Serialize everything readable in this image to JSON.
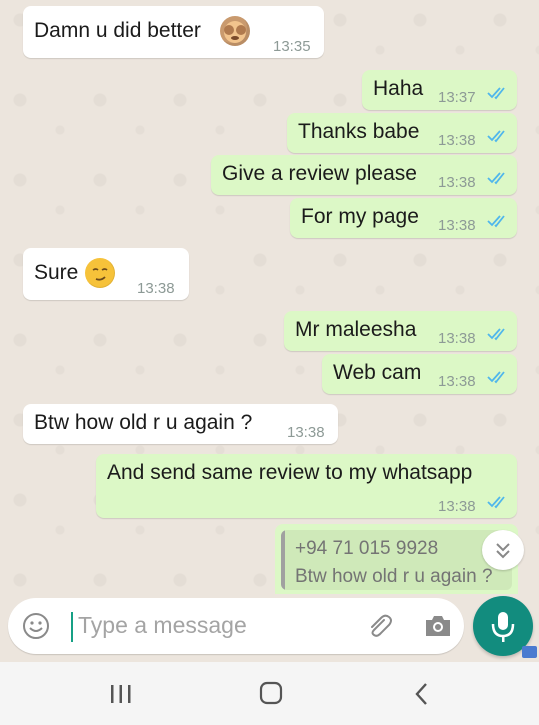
{
  "messages": [
    {
      "dir": "in",
      "text": "Damn u did better",
      "time": "13:35",
      "emoji": "see-no-evil-monkey-emoji"
    },
    {
      "dir": "out",
      "text": "Haha",
      "time": "13:37",
      "status": "read"
    },
    {
      "dir": "out",
      "text": "Thanks babe",
      "time": "13:38",
      "status": "read"
    },
    {
      "dir": "out",
      "text": "Give a review please",
      "time": "13:38",
      "status": "read"
    },
    {
      "dir": "out",
      "text": "For my page",
      "time": "13:38",
      "status": "read"
    },
    {
      "dir": "in",
      "text": "Sure",
      "time": "13:38",
      "emoji": "smirking-face-emoji"
    },
    {
      "dir": "out",
      "text": "Mr maleesha",
      "time": "13:38",
      "status": "read"
    },
    {
      "dir": "out",
      "text": "Web cam",
      "time": "13:38",
      "status": "read"
    },
    {
      "dir": "in",
      "text": "Btw how old r u again ?",
      "time": "13:38"
    },
    {
      "dir": "out",
      "text": "And send same review to my whatsapp",
      "time": "13:38",
      "status": "read"
    }
  ],
  "reply_preview": {
    "sender": "+94 71 015 9928",
    "text": "Btw how old r u again ?"
  },
  "composer": {
    "placeholder": "Type a message"
  },
  "colors": {
    "outgoing_bubble": "#dcf8c6",
    "incoming_bubble": "#ffffff",
    "chat_background": "#ece5dd",
    "accent": "#128c7e",
    "read_ticks": "#4fb6ec"
  },
  "icons": [
    "emoji-icon",
    "attach-icon",
    "camera-icon",
    "mic-icon",
    "chevron-double-down-icon",
    "recent-apps-icon",
    "home-icon",
    "back-icon"
  ]
}
